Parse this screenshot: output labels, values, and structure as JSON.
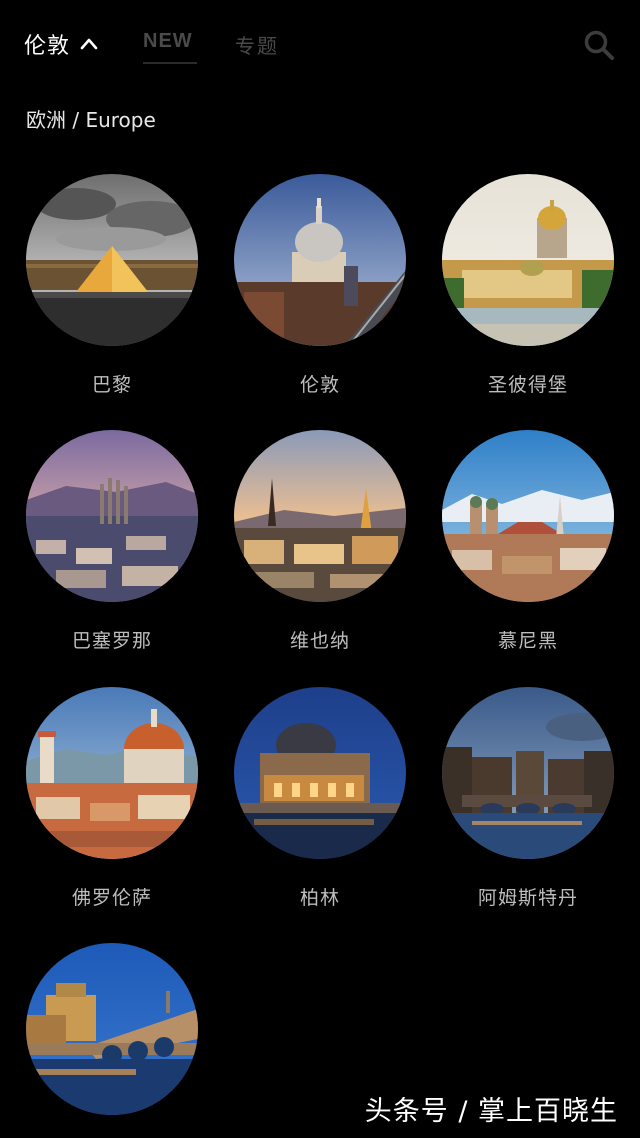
{
  "header": {
    "current_city": "伦敦",
    "tabs": [
      {
        "label": "NEW"
      },
      {
        "label": "专题"
      }
    ]
  },
  "region": {
    "title": "欧洲 / Europe"
  },
  "cities": [
    {
      "name": "巴黎"
    },
    {
      "name": "伦敦"
    },
    {
      "name": "圣彼得堡"
    },
    {
      "name": "巴塞罗那"
    },
    {
      "name": "维也纳"
    },
    {
      "name": "慕尼黑"
    },
    {
      "name": "佛罗伦萨"
    },
    {
      "name": "柏林"
    },
    {
      "name": "阿姆斯特丹"
    },
    {
      "name": ""
    }
  ],
  "watermark": "头条号 / 掌上百晓生",
  "colors": {
    "background": "#000000",
    "text_primary": "#ffffff",
    "text_secondary": "#bdbdbd",
    "tab_inactive": "#4a4a4a"
  }
}
